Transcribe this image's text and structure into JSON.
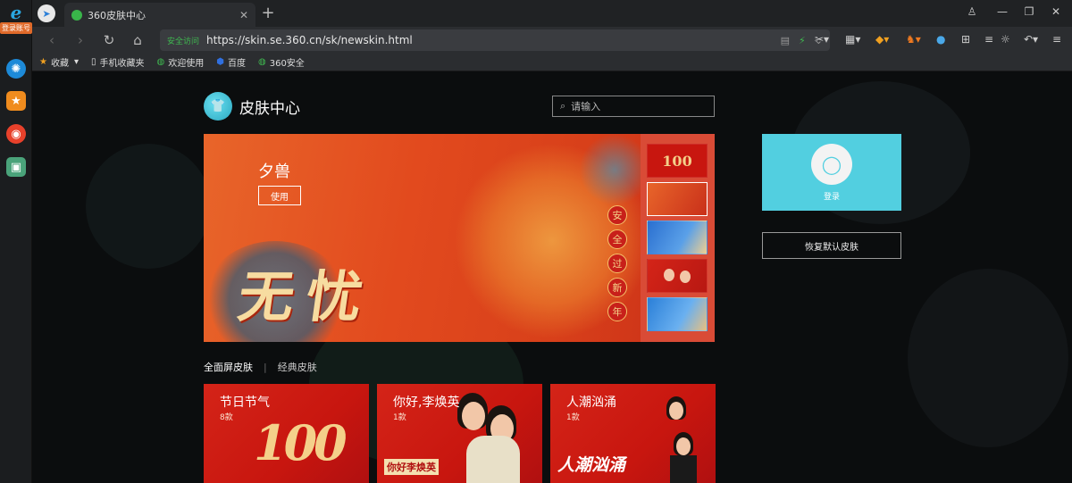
{
  "browser": {
    "tab_title": "360皮肤中心",
    "new_tab": "+",
    "address_secure": "安全访问 ",
    "address_url": "https://skin.se.360.cn/sk/newskin.html",
    "sidebar_login": "登录账号"
  },
  "bookmarks": [
    {
      "icon": "star-icon",
      "label": "收藏"
    },
    {
      "icon": "phone-icon",
      "label": "手机收藏夹"
    },
    {
      "icon": "globe-icon",
      "label": "欢迎使用"
    },
    {
      "icon": "baidu-icon",
      "label": "百度"
    },
    {
      "icon": "shield-icon",
      "label": "360安全"
    }
  ],
  "page": {
    "title": "皮肤中心",
    "search_placeholder": "请输入",
    "banner": {
      "skin_name": "夕兽",
      "use_label": "使用",
      "art_text": "无忧",
      "vertical_chars": [
        "安",
        "全",
        "过",
        "新",
        "年"
      ],
      "thumb_100": "100"
    },
    "login_label": "登录",
    "restore_label": "恢复默认皮肤",
    "category_tabs": [
      "全面屏皮肤",
      "经典皮肤"
    ],
    "cards": [
      {
        "title": "节日节气",
        "count": "8款",
        "deco": "100"
      },
      {
        "title": "你好,李焕英",
        "count": "1款",
        "deco": "你好李焕英"
      },
      {
        "title": "人潮汹涌",
        "count": "1款",
        "deco": "人潮汹涌"
      }
    ]
  }
}
